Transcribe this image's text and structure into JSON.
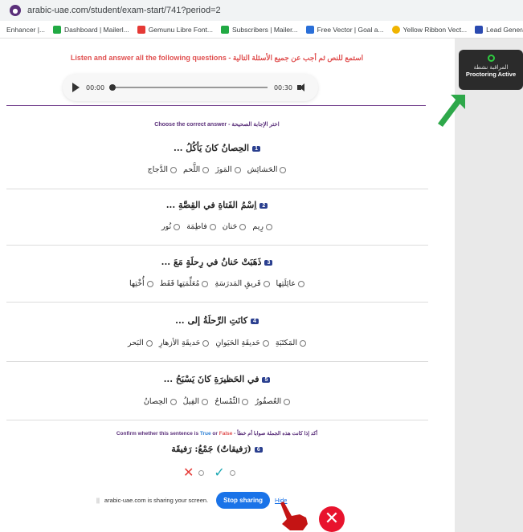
{
  "browser": {
    "url": "arabic-uae.com/student/exam-start/741?period=2",
    "bookmarks": [
      {
        "label": "Enhancer |...",
        "color": "#ffffff"
      },
      {
        "label": "Dashboard | Mailerl...",
        "color": "#22aa44"
      },
      {
        "label": "Gemunu Libre Font...",
        "color": "#e53935"
      },
      {
        "label": "Subscribers | Mailer...",
        "color": "#22aa44"
      },
      {
        "label": "Free Vector | Goal a...",
        "color": "#2a6fd8"
      },
      {
        "label": "Yellow Ribbon Vect...",
        "color": "#f0b400"
      },
      {
        "label": "Lead Generati",
        "color": "#2a4ab0"
      }
    ]
  },
  "proctor": {
    "arabic": "المراقبة نشطة",
    "english": "Proctoring Active"
  },
  "exam": {
    "listen_instruction": "Listen and answer all the following questions - استمع للنص ثم أجب عن جميع الأسئلة التالية",
    "audio": {
      "current": "00:00",
      "duration": "00:30"
    },
    "choose_instruction": "Choose the correct answer - اختر الإجابة الصحيحة",
    "questions": [
      {
        "num": "1",
        "text": "الحِصانُ كانَ يَأكُلُ ...",
        "options": [
          "الحَشائِش",
          "المَوزَ",
          "اللَّحم",
          "الدَّجاج"
        ]
      },
      {
        "num": "2",
        "text": "اِسْمُ الفَتاةِ في القِصَّةِ ...",
        "options": [
          "رِيم",
          "حَنان",
          "فاطِمَة",
          "نُور"
        ]
      },
      {
        "num": "3",
        "text": "ذَهَبَتْ حَنانُ في رِحلَةٍ مَعَ ...",
        "options": [
          "عائِلَتِها",
          "فَريقِ المَدرَسَةِ",
          "مُعَلِّمَتِها فَقَط",
          "أُخْتِها"
        ]
      },
      {
        "num": "4",
        "text": "كانَتِ الرِّحلَةُ إلى ...",
        "options": [
          "المَكتَبَةِ",
          "حَديقَةِ الحَيَوانِ",
          "حَديقَةِ الأزهارِ",
          "البَحر"
        ]
      },
      {
        "num": "5",
        "text": "في الحَظيرَةِ كانَ يَسْبَحُ ...",
        "options": [
          "العُصفُورُ",
          "التِّمْساحُ",
          "الفِيلُ",
          "الحِصانُ"
        ]
      }
    ],
    "tf_instruction_prefix": "Confirm whether this sentence is ",
    "tf_true": "True",
    "tf_or": " or ",
    "tf_false": "False",
    "tf_instruction_ar": " - أكد إذا كانت هذه الجملة صوابا أم خطأ",
    "tf_question_num": "6",
    "tf_question": "(رَفيقاتٌ) جَمْعُ: رَفيقَة"
  },
  "sharing": {
    "message": "arabic-uae.com is sharing your screen.",
    "stop_label": "Stop sharing",
    "hide_label": "Hide"
  }
}
